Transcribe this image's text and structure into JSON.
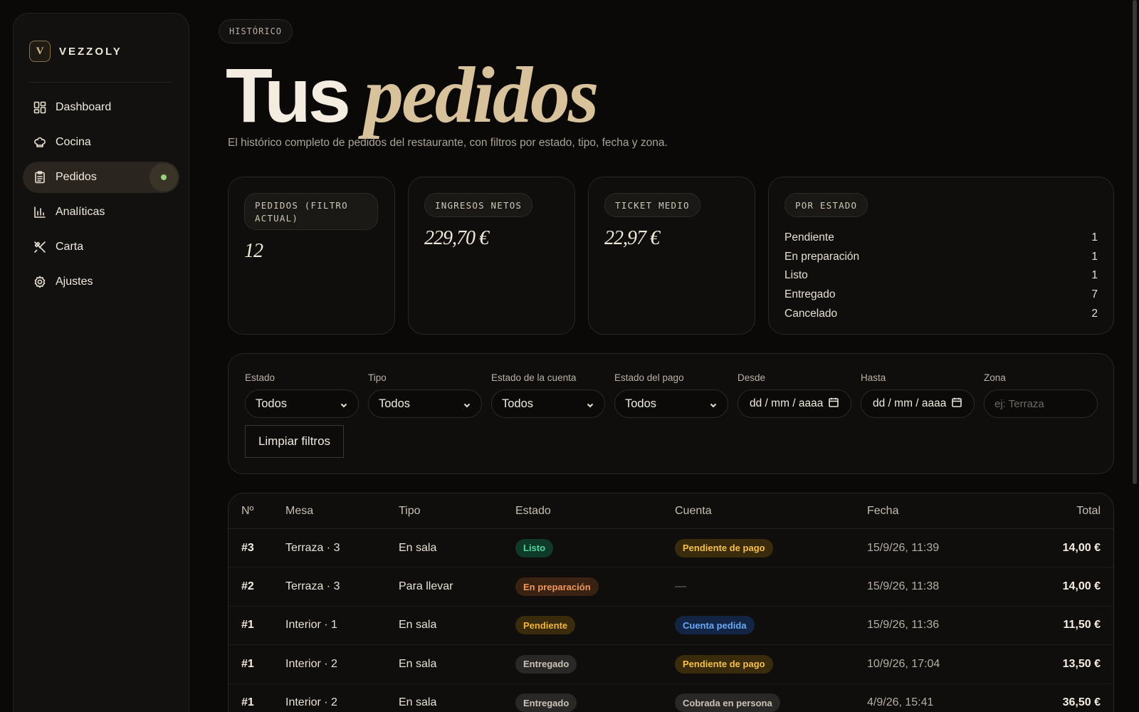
{
  "brand": {
    "logo_letter": "V",
    "name": "VEZZOLY"
  },
  "sidebar": {
    "items": [
      {
        "label": "Dashboard",
        "icon": "dashboard-icon"
      },
      {
        "label": "Cocina",
        "icon": "chef-hat-icon"
      },
      {
        "label": "Pedidos",
        "icon": "clipboard-icon",
        "active": true
      },
      {
        "label": "Analíticas",
        "icon": "bar-chart-icon"
      },
      {
        "label": "Carta",
        "icon": "utensils-icon"
      },
      {
        "label": "Ajustes",
        "icon": "gear-icon"
      }
    ]
  },
  "header": {
    "eyebrow": "HISTÓRICO",
    "title_plain": "Tus",
    "title_italic": "pedidos",
    "subtitle": "El histórico completo de pedidos del restaurante, con filtros por estado, tipo, fecha y zona."
  },
  "stats": {
    "orders": {
      "label": "PEDIDOS (FILTRO ACTUAL)",
      "value": "12"
    },
    "revenue": {
      "label": "INGRESOS NETOS",
      "value": "229,70 €"
    },
    "ticket": {
      "label": "TICKET MEDIO",
      "value": "22,97 €"
    },
    "by_status": {
      "label": "POR ESTADO",
      "rows": [
        {
          "name": "Pendiente",
          "count": "1"
        },
        {
          "name": "En preparación",
          "count": "1"
        },
        {
          "name": "Listo",
          "count": "1"
        },
        {
          "name": "Entregado",
          "count": "7"
        },
        {
          "name": "Cancelado",
          "count": "2"
        }
      ]
    }
  },
  "filters": {
    "estado": {
      "label": "Estado",
      "value": "Todos"
    },
    "tipo": {
      "label": "Tipo",
      "value": "Todos"
    },
    "cuenta": {
      "label": "Estado de la cuenta",
      "value": "Todos"
    },
    "pago": {
      "label": "Estado del pago",
      "value": "Todos"
    },
    "desde": {
      "label": "Desde",
      "value": "dd / mm / aaaa"
    },
    "hasta": {
      "label": "Hasta",
      "value": "dd / mm / aaaa"
    },
    "zona": {
      "label": "Zona",
      "placeholder": "ej: Terraza"
    },
    "clear_label": "Limpiar filtros"
  },
  "table": {
    "headers": [
      "Nº",
      "Mesa",
      "Tipo",
      "Estado",
      "Cuenta",
      "Fecha",
      "Total"
    ],
    "rows": [
      {
        "num": "#3",
        "mesa": "Terraza · 3",
        "tipo": "En sala",
        "estado": "Listo",
        "cuenta": "Pendiente de pago",
        "fecha": "15/9/26, 11:39",
        "total": "14,00 €"
      },
      {
        "num": "#2",
        "mesa": "Terraza · 3",
        "tipo": "Para llevar",
        "estado": "En preparación",
        "cuenta": "—",
        "fecha": "15/9/26, 11:38",
        "total": "14,00 €"
      },
      {
        "num": "#1",
        "mesa": "Interior · 1",
        "tipo": "En sala",
        "estado": "Pendiente",
        "cuenta": "Cuenta pedida",
        "fecha": "15/9/26, 11:36",
        "total": "11,50 €"
      },
      {
        "num": "#1",
        "mesa": "Interior · 2",
        "tipo": "En sala",
        "estado": "Entregado",
        "cuenta": "Pendiente de pago",
        "fecha": "10/9/26, 17:04",
        "total": "13,50 €"
      },
      {
        "num": "#1",
        "mesa": "Interior · 2",
        "tipo": "En sala",
        "estado": "Entregado",
        "cuenta": "Cobrada en persona",
        "fecha": "4/9/26, 15:41",
        "total": "36,50 €"
      }
    ]
  },
  "colors": {
    "listo": {
      "bg": "#0f3a2a",
      "fg": "#4fd49a"
    },
    "preparacion": {
      "bg": "#3a2212",
      "fg": "#f0975a"
    },
    "pendiente": {
      "bg": "#3a2b0c",
      "fg": "#f2b53a"
    },
    "entregado": {
      "bg": "#2a2826",
      "fg": "#c9c2b6"
    },
    "pago_pendiente": {
      "bg": "#3a2b0c",
      "fg": "#f5c04a"
    },
    "cuenta_pedida": {
      "bg": "#122544",
      "fg": "#6aa8f5"
    },
    "cobrada": {
      "bg": "#2a2826",
      "fg": "#c9c2b6"
    }
  }
}
